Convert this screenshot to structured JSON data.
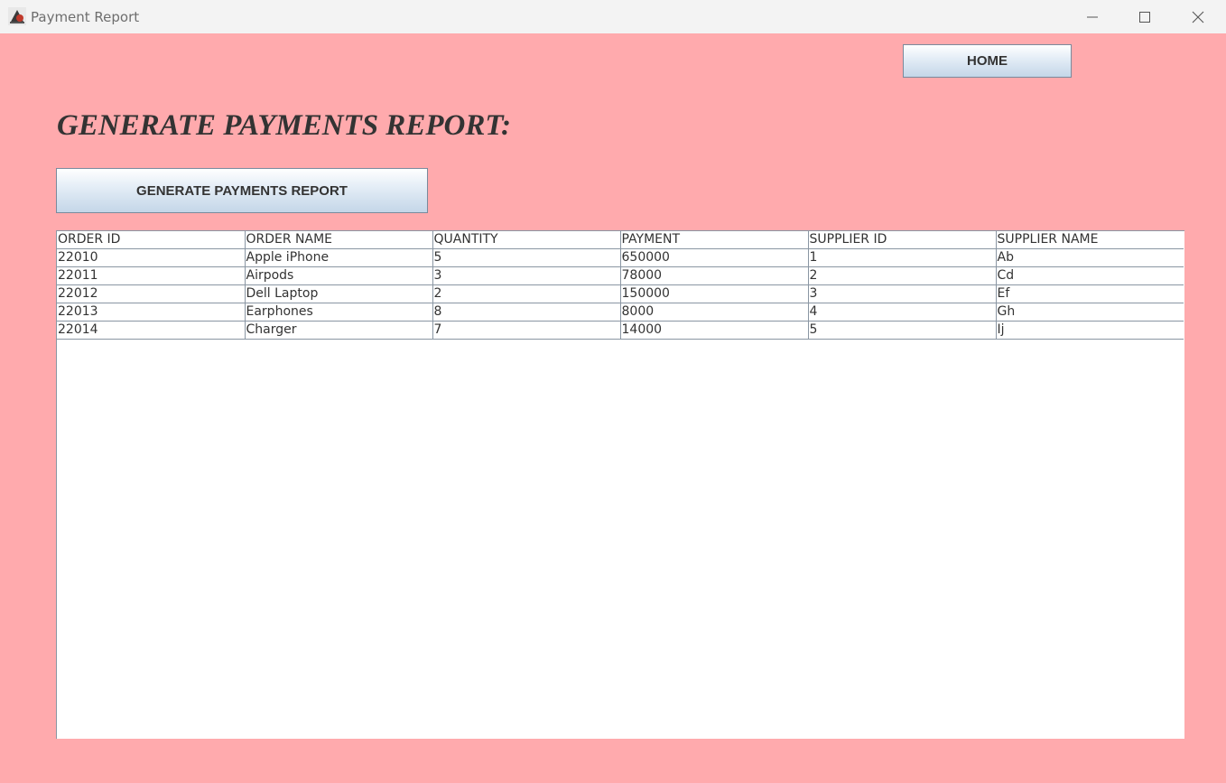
{
  "window": {
    "title": "Payment Report",
    "icon": "java-app-icon"
  },
  "header": {
    "home_label": "HOME"
  },
  "main": {
    "heading": "GENERATE PAYMENTS REPORT:",
    "generate_label": "GENERATE PAYMENTS REPORT"
  },
  "table": {
    "columns": [
      "ORDER ID",
      "ORDER NAME",
      "QUANTITY",
      "PAYMENT",
      "SUPPLIER ID",
      "SUPPLIER NAME"
    ],
    "rows": [
      [
        "22010",
        "Apple iPhone",
        "5",
        "650000",
        "1",
        "Ab"
      ],
      [
        "22011",
        "Airpods",
        "3",
        "78000",
        "2",
        "Cd"
      ],
      [
        "22012",
        "Dell Laptop",
        "2",
        "150000",
        "3",
        "Ef"
      ],
      [
        "22013",
        "Earphones",
        "8",
        "8000",
        "4",
        "Gh"
      ],
      [
        "22014",
        "Charger",
        "7",
        "14000",
        "5",
        "Ij"
      ]
    ]
  },
  "colors": {
    "background": "#ffaaad",
    "titlebar": "#f3f3f3",
    "text": "#333333"
  }
}
